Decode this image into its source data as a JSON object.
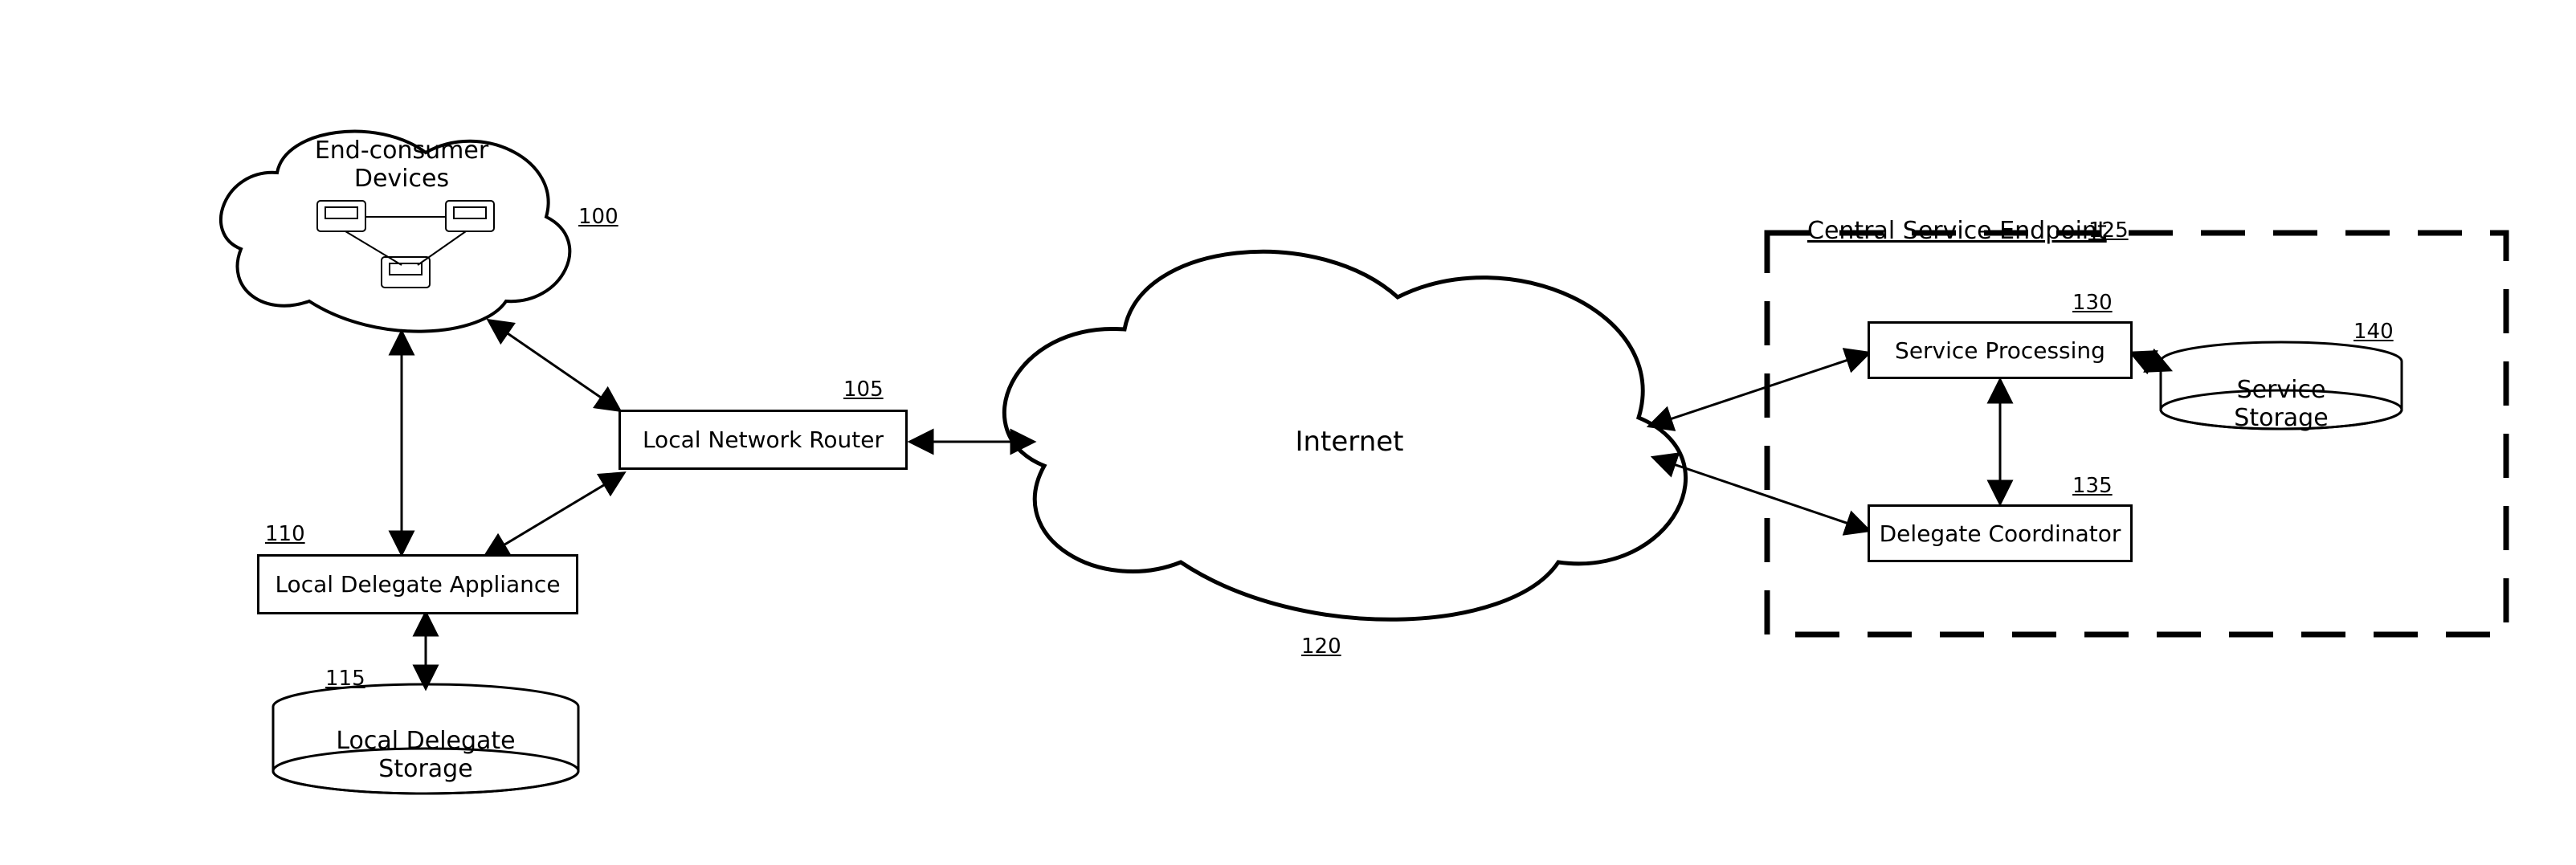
{
  "nodes": {
    "end_devices": {
      "label": "End-consumer Devices",
      "ref": "100"
    },
    "router": {
      "label": "Local Network Router",
      "ref": "105"
    },
    "delegate_appl": {
      "label": "Local Delegate Appliance",
      "ref": "110"
    },
    "delegate_store": {
      "label": "Local Delegate Storage",
      "ref": "115"
    },
    "internet": {
      "label": "Internet",
      "ref": "120"
    },
    "endpoint": {
      "label": "Central Service Endpoint",
      "ref": "125"
    },
    "service_proc": {
      "label": "Service Processing",
      "ref": "130"
    },
    "delegate_coord": {
      "label": "Delegate Coordinator",
      "ref": "135"
    },
    "service_store": {
      "label": "Service Storage",
      "ref": "140"
    }
  }
}
